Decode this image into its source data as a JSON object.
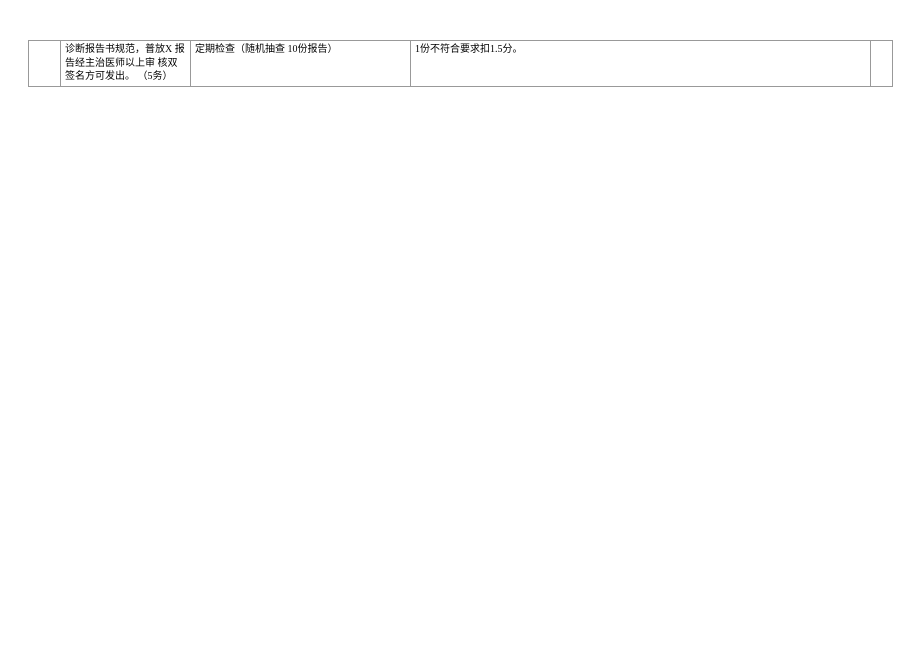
{
  "table": {
    "rows": [
      {
        "c0": "",
        "c1": "诊断报告书规范，普放X 报告经主治医师以上审 核双签名方可发出。            （5务）",
        "c2": "定期检查（随机抽查 10份报告）",
        "c3": "1份不符合要求扣1.5分。",
        "c4": ""
      }
    ]
  }
}
